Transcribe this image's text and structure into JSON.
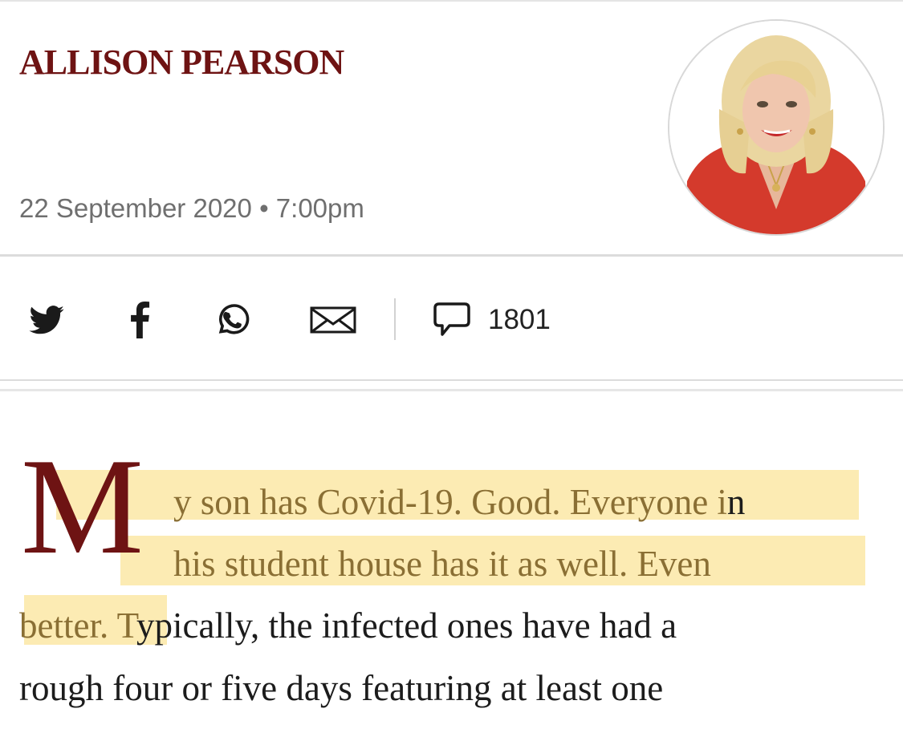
{
  "author": {
    "name": "ALLISON PEARSON",
    "date": "22 September 2020",
    "separator": "•",
    "time": "7:00pm"
  },
  "share": {
    "buttons": [
      {
        "name": "twitter",
        "icon": "twitter-bird-icon"
      },
      {
        "name": "facebook",
        "icon": "facebook-f-icon"
      },
      {
        "name": "whatsapp",
        "icon": "whatsapp-icon"
      },
      {
        "name": "email",
        "icon": "envelope-icon"
      }
    ],
    "comments_icon": "speech-bubble-icon",
    "comments_count": "1801"
  },
  "article": {
    "drop_cap": "M",
    "lines": [
      {
        "highlighted": "y son has Covid-19. Good. Everyone i",
        "plain": "n"
      },
      {
        "highlighted": "his student house has it as well. Even",
        "plain": ""
      },
      {
        "highlighted": "better. T",
        "plain": "ypically, the infected ones have had a"
      },
      {
        "highlighted": "",
        "plain": "rough four or five days featuring at least one"
      }
    ]
  },
  "colors": {
    "accent": "#6e1313",
    "meta_text": "#6f6f6f",
    "body_text": "#1c1c1c",
    "highlight": "#fbe8a6",
    "highlighted_text": "#8a6f34",
    "rule": "#dcdcdc"
  }
}
